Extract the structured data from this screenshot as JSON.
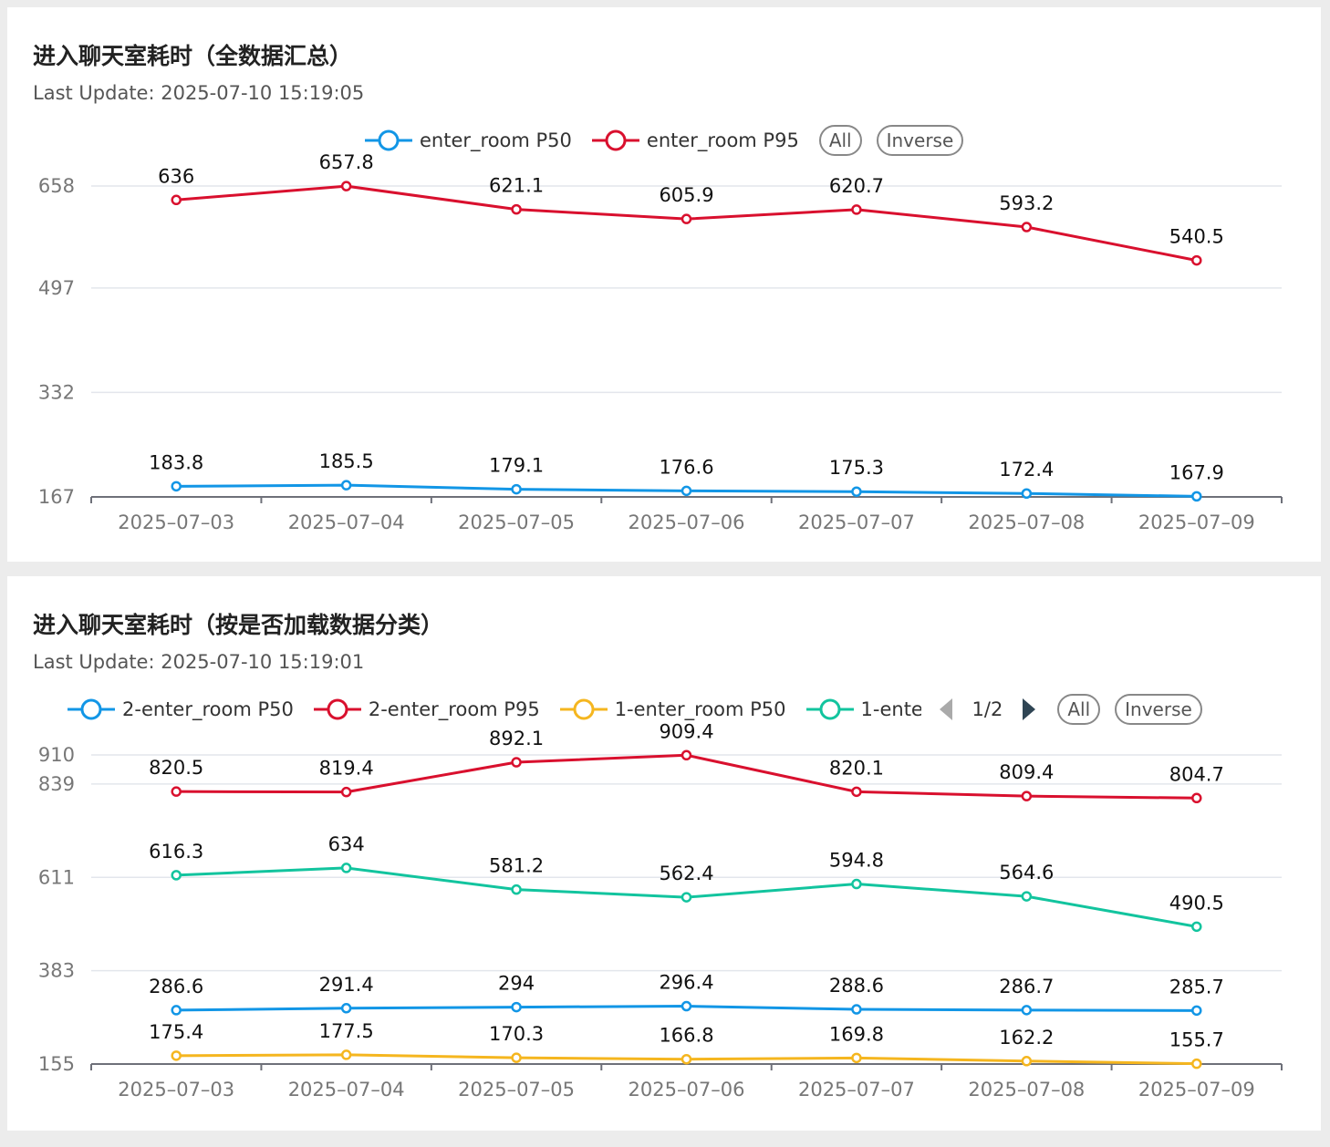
{
  "panels": [
    {
      "title": "进入聊天室耗时（全数据汇总）",
      "last_update": "Last Update: 2025-07-10 15:19:05"
    },
    {
      "title": "进入聊天室耗时（按是否加载数据分类）",
      "last_update": "Last Update: 2025-07-10 15:19:01"
    }
  ],
  "legend_controls": {
    "all_label": "All",
    "inverse_label": "Inverse",
    "page_label": "1/2"
  },
  "chart_data": [
    {
      "type": "line",
      "categories": [
        "2025-07-03",
        "2025-07-04",
        "2025-07-05",
        "2025-07-06",
        "2025-07-07",
        "2025-07-08",
        "2025-07-09"
      ],
      "y_ticks": [
        167,
        332,
        497,
        658
      ],
      "ylim": [
        167,
        658
      ],
      "grid": true,
      "legend_position": "top-center",
      "series": [
        {
          "name": "enter_room P50",
          "color": "#1296e6",
          "values": [
            183.8,
            185.5,
            179.1,
            176.6,
            175.3,
            172.4,
            167.9
          ]
        },
        {
          "name": "enter_room P95",
          "color": "#d9102e",
          "values": [
            636,
            657.8,
            621.1,
            605.9,
            620.7,
            593.2,
            540.5
          ]
        }
      ]
    },
    {
      "type": "line",
      "categories": [
        "2025-07-03",
        "2025-07-04",
        "2025-07-05",
        "2025-07-06",
        "2025-07-07",
        "2025-07-08",
        "2025-07-09"
      ],
      "y_ticks": [
        155,
        383,
        611,
        839,
        910
      ],
      "ylim": [
        155,
        910
      ],
      "grid": true,
      "legend_position": "top",
      "series": [
        {
          "name": "2-enter_room P50",
          "color": "#1296e6",
          "values": [
            286.6,
            291.4,
            294,
            296.4,
            288.6,
            286.7,
            285.7
          ]
        },
        {
          "name": "2-enter_room P95",
          "color": "#d9102e",
          "values": [
            820.5,
            819.4,
            892.1,
            909.4,
            820.1,
            809.4,
            804.7
          ]
        },
        {
          "name": "1-enter_room P50",
          "color": "#f5b61f",
          "values": [
            175.4,
            177.5,
            170.3,
            166.8,
            169.8,
            162.2,
            155.7
          ]
        },
        {
          "name": "1-ente",
          "color": "#12c49e",
          "values": [
            616.3,
            634,
            581.2,
            562.4,
            594.8,
            564.6,
            490.5
          ]
        }
      ]
    }
  ]
}
